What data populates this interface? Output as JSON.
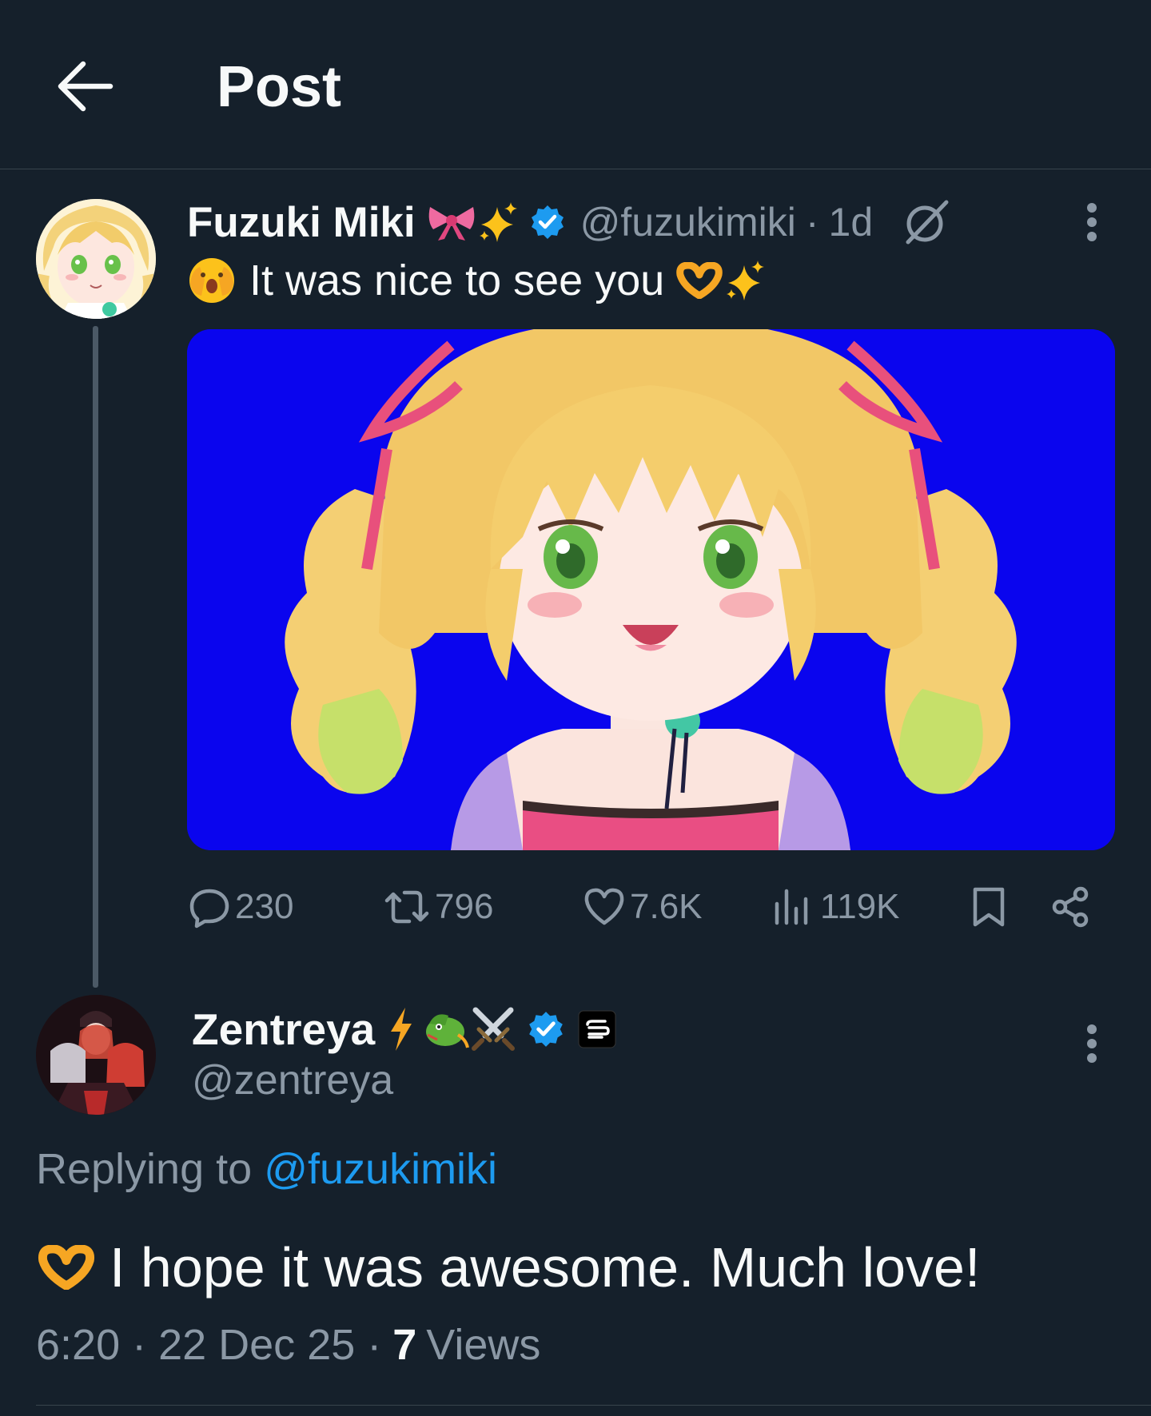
{
  "header": {
    "title": "Post",
    "back_icon": "arrow-left-icon"
  },
  "post": {
    "author": {
      "name": "Fuzuki Miki",
      "name_emojis": [
        "🎀",
        "✨"
      ],
      "verified": true,
      "handle": "@fuzukimiki",
      "separator": "·",
      "time": "1d"
    },
    "text_prefix_emoji": "🫣",
    "text": "It was nice to see you",
    "text_suffix_emojis": [
      "🫶",
      "✨"
    ],
    "stats": {
      "replies": "230",
      "reposts": "796",
      "likes": "7.6K",
      "views": "119K"
    }
  },
  "reply": {
    "author": {
      "name": "Zentreya",
      "name_emojis": [
        "⚡",
        "🐉",
        "⚔️"
      ],
      "verified": true,
      "handle": "@zentreya"
    },
    "replying_prefix": "Replying to",
    "replying_to": "@fuzukimiki",
    "text_prefix_emoji": "🫶",
    "text": "I hope it was awesome. Much love!",
    "date": "6:20 · 22 Dec 25 ·",
    "views_count": "7",
    "views_label": "Views"
  },
  "colors": {
    "background": "#15202b",
    "text": "#f7f9f9",
    "secondary": "#8b98a5",
    "accent": "#1d9bf0",
    "border": "#38444d",
    "media_bg": "#0a05ee"
  }
}
